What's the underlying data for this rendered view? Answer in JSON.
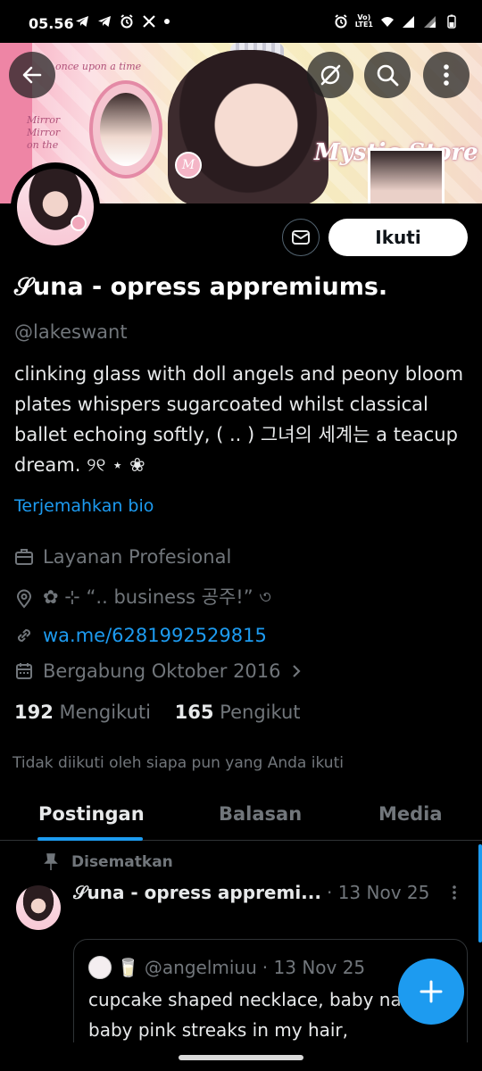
{
  "status_bar": {
    "time": "05.56",
    "volte": "Vo)",
    "lte": "LTE1",
    "icons": [
      "telegram-icon",
      "telegram-icon",
      "alarm-icon",
      "x-icon",
      "notification-dot",
      "alarm-icon",
      "volte-icon",
      "wifi-icon",
      "signal-icon",
      "signal-icon",
      "battery-icon"
    ]
  },
  "banner": {
    "text_store": "Mystic Store",
    "text_once": "once upon a time",
    "text_mirror": "Mirror\nMirror\non the",
    "badge": "M"
  },
  "profile": {
    "name": "𝒮una - opress appremiums.",
    "handle": "@lakeswant",
    "bio": "clinking glass with doll angels and peony bloom plates whispers sugarcoated whilst classical ballet echoing softly, ( .. ) 그녀의 세계는 a teacup dream. ୨୧ ⋆ ❀",
    "translate_label": "Terjemahkan bio",
    "category": "Layanan Profesional",
    "location": "✿ ⊹ “.. business 공주!” ৩",
    "link": "wa.me/6281992529815",
    "joined": "Bergabung Oktober 2016",
    "following_count": "192",
    "following_label": "Mengikuti",
    "followers_count": "165",
    "followers_label": "Pengikut",
    "not_followed": "Tidak diikuti oleh siapa pun yang Anda ikuti"
  },
  "buttons": {
    "follow": "Ikuti"
  },
  "tabs": [
    {
      "label": "Postingan",
      "active": true
    },
    {
      "label": "Balasan",
      "active": false
    },
    {
      "label": "Media",
      "active": false
    }
  ],
  "post": {
    "pinned_label": "Disematkan",
    "author": "𝒮una - opress appremi...",
    "date": "· 13 Nov 25",
    "quote": {
      "emoji": "🥛",
      "handle": "@angelmiuu",
      "date": "· 13 Nov 25",
      "text": "cupcake shaped necklace, baby nails, baby pink streaks in my hair,"
    }
  },
  "colors": {
    "accent": "#1d9bf0",
    "muted": "#71767b",
    "text": "#e7e9ea",
    "background": "#000000"
  }
}
